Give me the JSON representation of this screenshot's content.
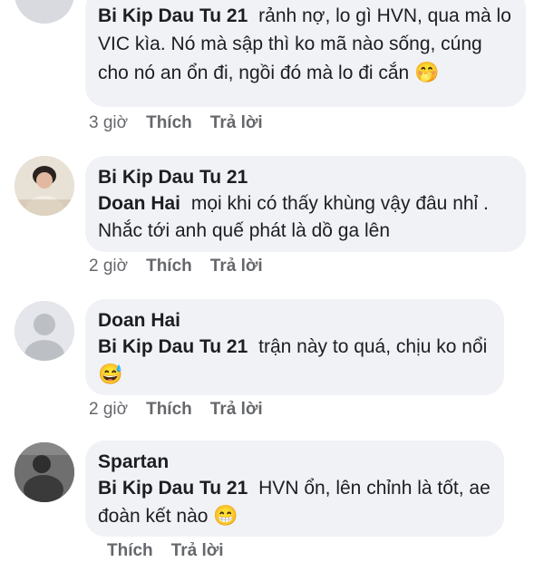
{
  "comments": [
    {
      "author": "Bi Kip Dau Tu 21",
      "tag": "",
      "text": "rảnh nợ, lo gì HVN, qua mà lo VIC kìa. Nó mà sập thì ko mã nào sống, cúng cho nó an ổn đi, ngồi đó mà lo đi cắn",
      "emoji": "🤭",
      "time": "3 giờ",
      "like": "Thích",
      "reply": "Trả lời"
    },
    {
      "author": "Bi Kip Dau Tu 21",
      "tag": "Doan Hai",
      "text": "mọi khi có thấy khùng vậy đâu nhỉ . Nhắc tới anh quế phát là dồ ga lên",
      "emoji": "",
      "time": "2 giờ",
      "like": "Thích",
      "reply": "Trả lời"
    },
    {
      "author": "Doan Hai",
      "tag": "Bi Kip Dau Tu 21",
      "text": "trận này to quá, chịu ko nổi",
      "emoji": "😅",
      "time": "2 giờ",
      "like": "Thích",
      "reply": "Trả lời"
    },
    {
      "author": "Spartan",
      "tag": "Bi Kip Dau Tu 21",
      "text": "HVN ổn, lên chỉnh là tốt, ae đoàn kết nào",
      "emoji": "😁",
      "time": "",
      "like": "Thích",
      "reply": "Trả lời"
    }
  ]
}
